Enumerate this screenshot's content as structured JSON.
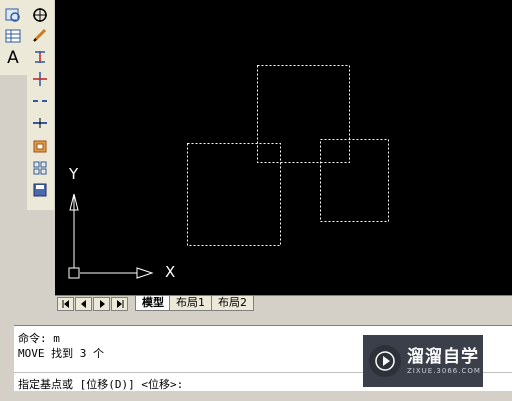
{
  "canvas": {
    "ucs_y": "Y",
    "ucs_x": "X"
  },
  "tabs": [
    {
      "label": "模型"
    },
    {
      "label": "布局1"
    },
    {
      "label": "布局2"
    }
  ],
  "command": {
    "line1": "命令: m",
    "line2": "MOVE 找到 3 个",
    "prompt": "指定基点或 [位移(D)] <位移>:"
  },
  "watermark": {
    "title": "溜溜自学",
    "url": "ZIXUE.3066.COM"
  },
  "colors": {
    "canvas_bg": "#000000",
    "selection": "#ffffff"
  }
}
